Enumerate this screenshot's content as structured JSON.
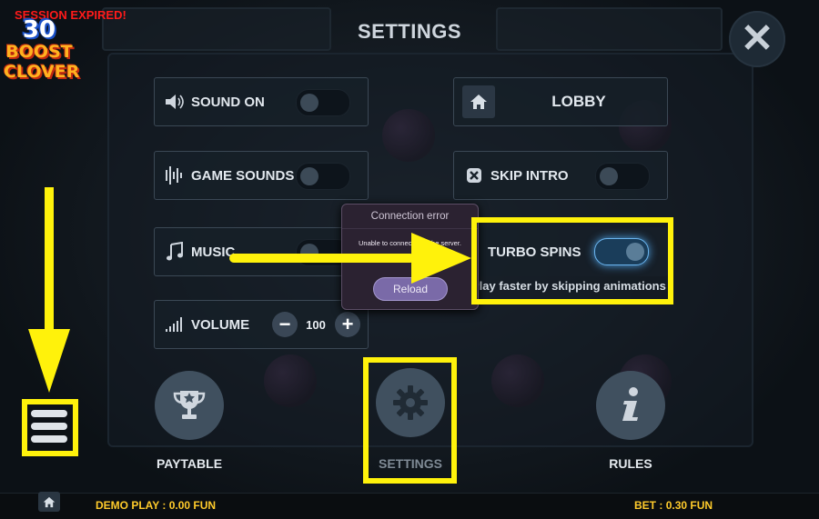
{
  "status": {
    "session": "SESSION EXPIRED!"
  },
  "logo": {
    "number": "30",
    "line1": "BOOST",
    "line2": "CLOVER"
  },
  "header": {
    "title": "SETTINGS",
    "close_icon": "close-icon"
  },
  "settings": {
    "sound": {
      "label": "SOUND ON",
      "enabled": false,
      "icon": "speaker-icon"
    },
    "game_sounds": {
      "label": "GAME SOUNDS",
      "enabled": false,
      "icon": "equalizer-icon"
    },
    "music": {
      "label": "MUSIC",
      "enabled": false,
      "icon": "music-note-icon"
    },
    "volume": {
      "label": "VOLUME",
      "value": "100",
      "minus": "−",
      "plus": "+",
      "icon": "signal-bars-icon"
    },
    "lobby": {
      "label": "LOBBY",
      "icon": "home-icon"
    },
    "skip_intro": {
      "label": "SKIP INTRO",
      "enabled": false,
      "icon": "close-square-icon"
    },
    "turbo_spins": {
      "label": "TURBO SPINS",
      "enabled": true,
      "description": "Play faster by skipping animations"
    }
  },
  "modal": {
    "title": "Connection error",
    "message": "Unable to connect with the server.",
    "button": "Reload"
  },
  "nav": {
    "paytable": {
      "label": "PAYTABLE",
      "icon": "trophy-icon"
    },
    "settings": {
      "label": "SETTINGS",
      "icon": "gear-icon"
    },
    "rules": {
      "label": "RULES",
      "icon": "info-icon"
    }
  },
  "bottom": {
    "demo_label": "DEMO PLAY :",
    "demo_value": "0.00 FUN",
    "bet_label": "BET :",
    "bet_value": "0.30 FUN"
  },
  "colors": {
    "highlight": "#fff20b",
    "accent_gold": "#ffcb2b",
    "error_red": "#ff1a1a"
  }
}
